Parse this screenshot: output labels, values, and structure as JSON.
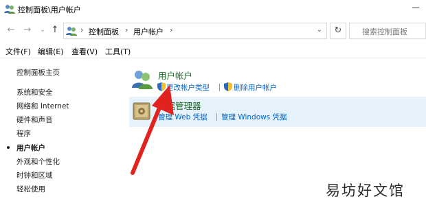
{
  "window": {
    "title": "控制面板\\用户帐户"
  },
  "nav": {
    "back": "←",
    "forward": "→",
    "history": "⌄",
    "up": "↑",
    "breadcrumb": [
      "控制面板",
      "用户帐户"
    ],
    "separator": "›",
    "refresh": "↻",
    "search_placeholder": "搜索控制面板"
  },
  "menu": [
    "文件(F)",
    "编辑(E)",
    "查看(V)",
    "工具(T)"
  ],
  "sidebar": {
    "home": "控制面板主页",
    "items": [
      "系统和安全",
      "网络和 Internet",
      "硬件和声音",
      "程序",
      "用户帐户",
      "外观和个性化",
      "时钟和区域",
      "轻松使用"
    ],
    "active_index": 4
  },
  "main": {
    "user_accounts": {
      "title": "用户帐户",
      "links": [
        "更改帐户类型",
        "删除用户帐户"
      ]
    },
    "credential_manager": {
      "title": "凭据管理器",
      "links": [
        "管理 Web 凭据",
        "管理 Windows 凭据"
      ]
    }
  },
  "watermark": "易坊好文馆",
  "colors": {
    "link": "#0066cc",
    "category_title": "#1e6b27",
    "hover_bg": "#e5f1fb",
    "arrow": "#e0231f"
  }
}
